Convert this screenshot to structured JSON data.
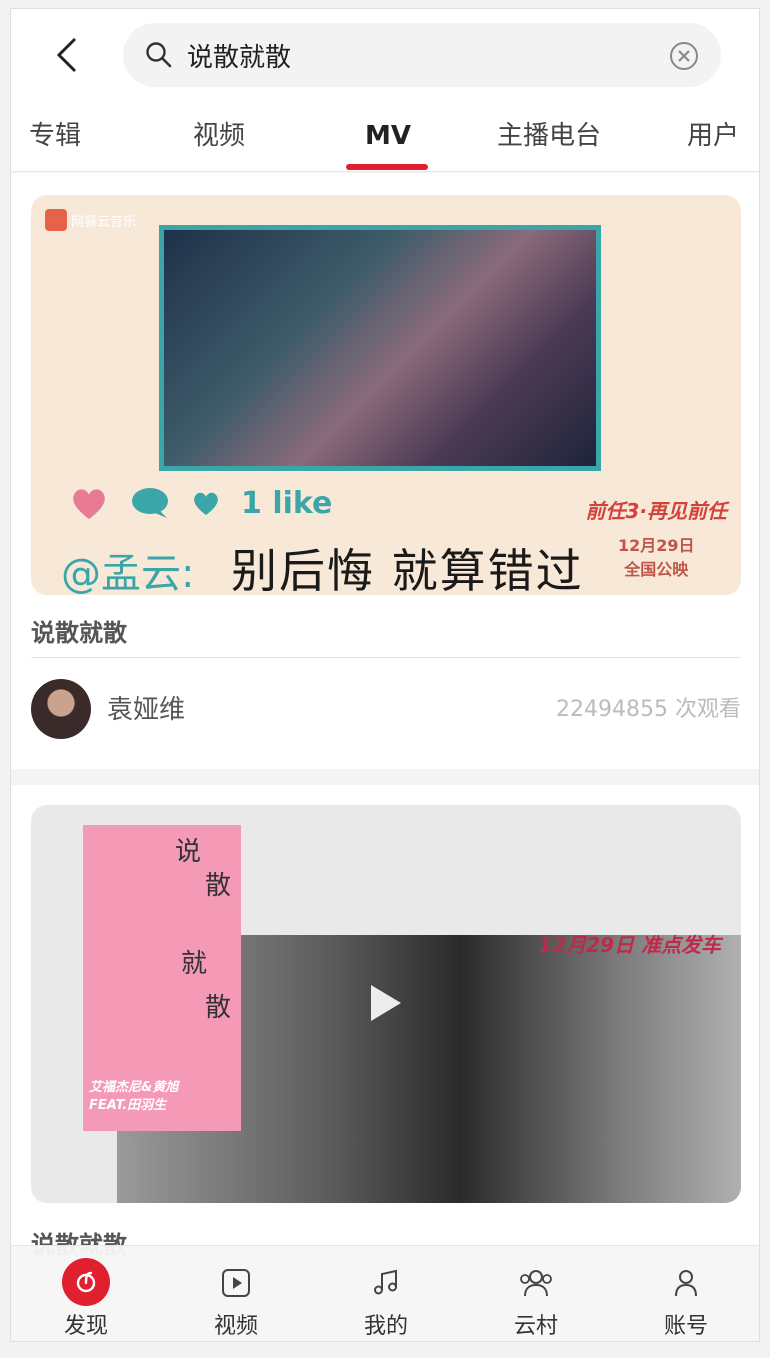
{
  "header": {
    "search_query": "说散就散"
  },
  "tabs": [
    {
      "label": "专辑"
    },
    {
      "label": "视频"
    },
    {
      "label": "MV"
    },
    {
      "label": "主播电台"
    },
    {
      "label": "用户"
    }
  ],
  "active_tab": "MV",
  "results": [
    {
      "title": "说散就散",
      "artist": "袁娅维",
      "views": "22494855 次观看",
      "thumb": {
        "watermark": "网易云音乐",
        "likes_text": "1 like",
        "handle": "@孟云:",
        "caption": "别后悔 就算错过",
        "promo_title": "前任3·再见前任",
        "promo_date": "12月29日",
        "promo_sub": "全国公映"
      }
    },
    {
      "title": "说散就散",
      "thumb": {
        "words": [
          "说",
          "散",
          "就",
          "散"
        ],
        "feat_line1": "艾福杰尼&黄旭",
        "feat_line2": "FEAT.田羽生",
        "date_text": "12月29日 准点发车"
      }
    }
  ],
  "tabbar": {
    "items": [
      {
        "label": "发现",
        "icon": "netease-music-icon"
      },
      {
        "label": "视频",
        "icon": "video-play-icon"
      },
      {
        "label": "我的",
        "icon": "music-note-icon"
      },
      {
        "label": "云村",
        "icon": "group-icon"
      },
      {
        "label": "账号",
        "icon": "user-icon"
      }
    ]
  },
  "colors": {
    "accent": "#e0202f",
    "teal": "#3aa6a8",
    "pink": "#f49ab6"
  }
}
